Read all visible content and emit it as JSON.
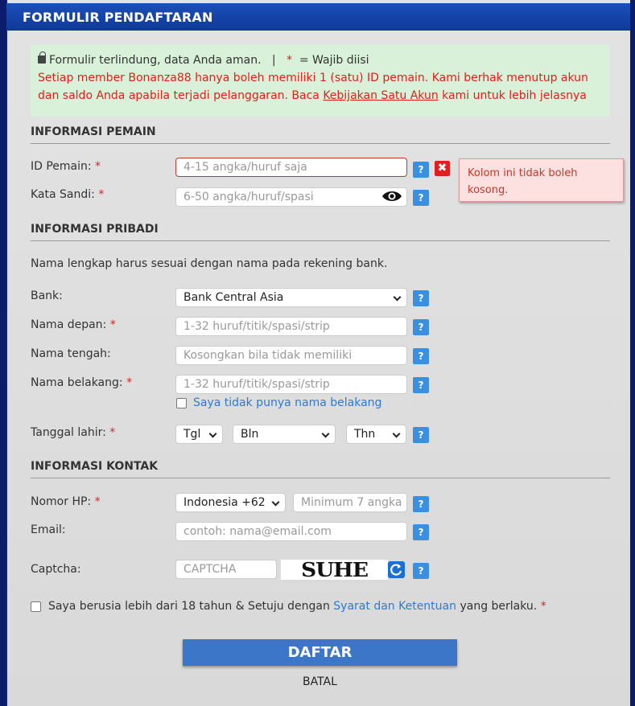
{
  "header": {
    "title": "FORMULIR PENDAFTARAN"
  },
  "notice": {
    "secure": "Formulir terlindung, data Anda aman.",
    "separator": "|",
    "star": "*",
    "required_note": "= Wajib diisi",
    "warning_before": "Setiap member Bonanza88 hanya boleh memiliki 1 (satu) ID pemain. Kami berhak menutup akun dan saldo Anda apabila terjadi pelanggaran. Baca ",
    "warning_link": "Kebijakan Satu Akun",
    "warning_after": " kami untuk lebih jelasnya"
  },
  "sections": {
    "player": "INFORMASI PEMAIN",
    "personal": "INFORMASI PRIBADI",
    "contact": "INFORMASI KONTAK"
  },
  "fields": {
    "player_id": {
      "label": "ID Pemain:",
      "placeholder": "4-15 angka/huruf saja"
    },
    "password": {
      "label": "Kata Sandi:",
      "placeholder": "6-50 angka/huruf/spasi"
    },
    "error_tooltip": "Kolom ini tidak boleh kosong.",
    "personal_note": "Nama lengkap harus sesuai dengan nama pada rekening bank.",
    "bank": {
      "label": "Bank:",
      "value": "Bank Central Asia"
    },
    "first_name": {
      "label": "Nama depan:",
      "placeholder": "1-32 huruf/titik/spasi/strip"
    },
    "middle_name": {
      "label": "Nama tengah:",
      "placeholder": "Kosongkan bila tidak memiliki"
    },
    "last_name": {
      "label": "Nama belakang:",
      "placeholder": "1-32 huruf/titik/spasi/strip"
    },
    "no_last_name": "Saya tidak punya nama belakang",
    "birthdate": {
      "label": "Tanggal lahir:",
      "day": "Tgl",
      "month": "Bln",
      "year": "Thn"
    },
    "phone": {
      "label": "Nomor HP:",
      "country": "Indonesia +62",
      "placeholder": "Minimum 7 angka"
    },
    "email": {
      "label": "Email:",
      "placeholder": "contoh: nama@email.com"
    },
    "captcha": {
      "label": "Captcha:",
      "placeholder": "CAPTCHA",
      "image_text": "SUHE"
    },
    "agree_before": "Saya berusia lebih dari 18 tahun & Setuju dengan ",
    "agree_link": "Syarat dan Ketentuan",
    "agree_after": " yang berlaku.",
    "required_star": "*",
    "help_glyph": "?",
    "close_glyph": "✖"
  },
  "buttons": {
    "submit": "DAFTAR",
    "cancel": "BATAL"
  }
}
